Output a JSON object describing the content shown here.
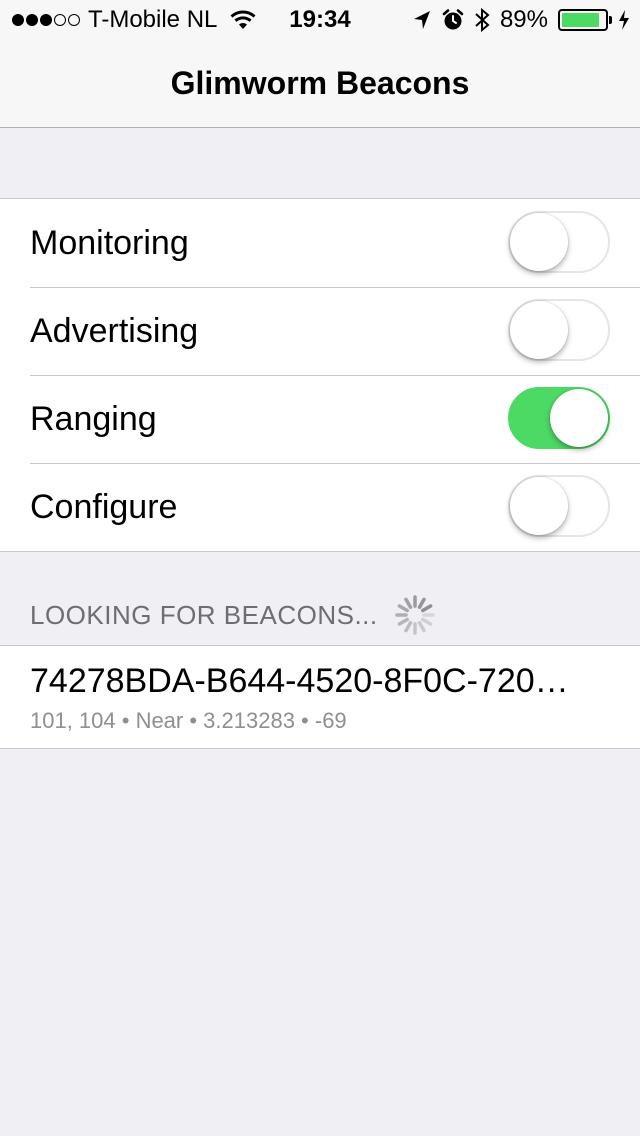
{
  "status_bar": {
    "carrier": "T-Mobile NL",
    "time": "19:34",
    "battery_percent": "89%",
    "battery_level": 0.89,
    "signal_bars_filled": 3,
    "signal_bars_total": 5,
    "icons": [
      "wifi-icon",
      "location-arrow-icon",
      "alarm-icon",
      "bluetooth-icon",
      "charging-bolt-icon"
    ]
  },
  "navbar": {
    "title": "Glimworm Beacons"
  },
  "settings": {
    "rows": [
      {
        "label": "Monitoring",
        "on": false
      },
      {
        "label": "Advertising",
        "on": false
      },
      {
        "label": "Ranging",
        "on": true
      },
      {
        "label": "Configure",
        "on": false
      }
    ]
  },
  "section": {
    "header": "LOOKING FOR BEACONS..."
  },
  "beacons": [
    {
      "uuid": "74278BDA-B644-4520-8F0C-720…",
      "details": "101, 104 • Near • 3.213283 • -69"
    }
  ],
  "colors": {
    "toggle_on": "#4cd964",
    "background": "#efeff4",
    "secondary_text": "#8e8e93",
    "header_text": "#6d6d72"
  }
}
